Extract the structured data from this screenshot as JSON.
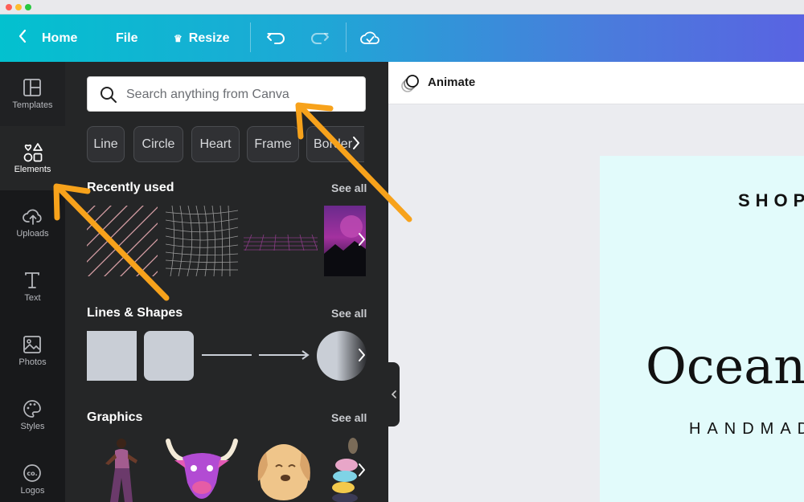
{
  "topbar": {
    "home_label": "Home",
    "file_label": "File",
    "resize_label": "Resize"
  },
  "rail": {
    "items": [
      {
        "label": "Templates",
        "icon": "templates-icon"
      },
      {
        "label": "Elements",
        "icon": "elements-icon"
      },
      {
        "label": "Uploads",
        "icon": "upload-cloud-icon"
      },
      {
        "label": "Text",
        "icon": "text-icon"
      },
      {
        "label": "Photos",
        "icon": "photos-icon"
      },
      {
        "label": "Styles",
        "icon": "palette-icon"
      },
      {
        "label": "Logos",
        "icon": "logo-icon"
      }
    ]
  },
  "panel": {
    "search_placeholder": "Search anything from Canva",
    "chips": [
      "Line",
      "Circle",
      "Heart",
      "Frame",
      "Border"
    ],
    "sections": [
      {
        "title": "Recently used",
        "see_all": "See all"
      },
      {
        "title": "Lines & Shapes",
        "see_all": "See all"
      },
      {
        "title": "Graphics",
        "see_all": "See all"
      }
    ]
  },
  "canvas": {
    "animate_label": "Animate",
    "page_text_top": "SHOP",
    "page_text_main": "Ocean",
    "page_text_bottom": "HANDMADE"
  },
  "colors": {
    "topbar_start": "#03c1cf",
    "topbar_end": "#5963e2",
    "annotation_arrow": "#f7a21b",
    "panel_bg": "#252627",
    "page_bg": "#e2fbfb"
  }
}
